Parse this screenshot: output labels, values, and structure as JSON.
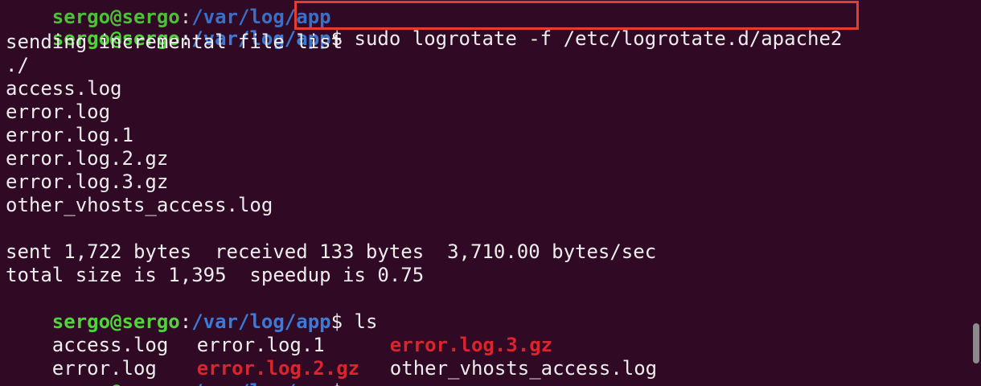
{
  "prompt": {
    "user_host": "sergo@sergo",
    "separator": ":",
    "path": "/var/log/app",
    "symbol": "$"
  },
  "commands": {
    "logrotate": " sudo logrotate -f /etc/logrotate.d/apache2",
    "ls": " ls"
  },
  "output": {
    "sending": "sending incremental file list",
    "dot": "./",
    "files": [
      "access.log",
      "error.log",
      "error.log.1",
      "error.log.2.gz",
      "error.log.3.gz",
      "other_vhosts_access.log"
    ],
    "sent": "sent 1,722 bytes  received 133 bytes  3,710.00 bytes/sec",
    "total": "total size is 1,395  speedup is 0.75"
  },
  "ls_output": {
    "row1": [
      "access.log",
      "error.log.1",
      "error.log.3.gz"
    ],
    "row2": [
      "error.log",
      "error.log.2.gz",
      "other_vhosts_access.log"
    ]
  },
  "colors": {
    "background": "#300a24",
    "user": "#4fd53a",
    "path": "#3a7ad8",
    "archive": "#d8262e",
    "highlight": "#e43b32"
  }
}
